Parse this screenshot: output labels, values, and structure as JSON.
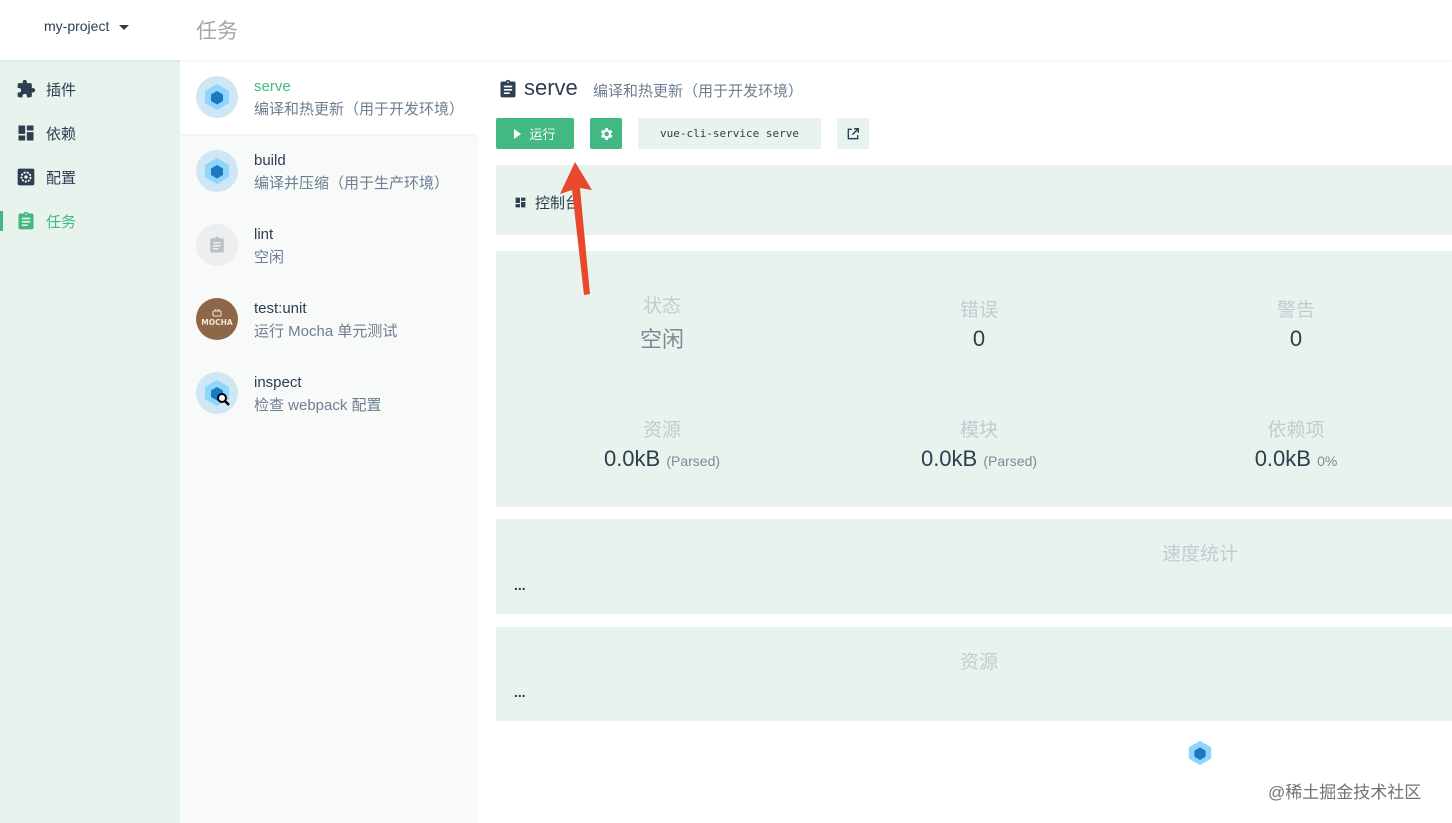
{
  "header": {
    "project": "my-project",
    "title": "任务"
  },
  "nav": {
    "items": [
      {
        "label": "插件",
        "icon": "puzzle-icon"
      },
      {
        "label": "依赖",
        "icon": "dashboard-icon"
      },
      {
        "label": "配置",
        "icon": "gear-box-icon"
      },
      {
        "label": "任务",
        "icon": "clipboard-icon",
        "active": true
      }
    ]
  },
  "tasks": [
    {
      "name": "serve",
      "desc": "编译和热更新（用于开发环境）",
      "icon": "webpack-icon",
      "selected": true
    },
    {
      "name": "build",
      "desc": "编译并压缩（用于生产环境）",
      "icon": "webpack-icon"
    },
    {
      "name": "lint",
      "desc": "空闲",
      "icon": "clipboard-icon"
    },
    {
      "name": "test:unit",
      "desc": "运行 Mocha 单元测试",
      "icon": "mocha-icon"
    },
    {
      "name": "inspect",
      "desc": "检查 webpack 配置",
      "icon": "webpack-inspect-icon"
    }
  ],
  "main": {
    "name": "serve",
    "desc": "编译和热更新（用于开发环境）",
    "run_label": "运行",
    "command": "vue-cli-service serve",
    "console_tab": "控制台",
    "stats": {
      "status_label": "状态",
      "status_value": "空闲",
      "errors_label": "错误",
      "errors_value": "0",
      "warnings_label": "警告",
      "warnings_value": "0",
      "assets_label": "资源",
      "assets_value": "0.0kB",
      "assets_unit": "(Parsed)",
      "modules_label": "模块",
      "modules_value": "0.0kB",
      "modules_unit": "(Parsed)",
      "deps_label": "依赖项",
      "deps_value": "0.0kB",
      "deps_unit": "0%"
    },
    "speed_title": "速度统计",
    "speed_placeholder": "...",
    "assets_title": "资源",
    "assets_placeholder": "..."
  },
  "watermark": "@稀土掘金技术社区",
  "colors": {
    "accent": "#42b983",
    "panel": "#e8f3ee",
    "arrow": "#e8492c"
  }
}
